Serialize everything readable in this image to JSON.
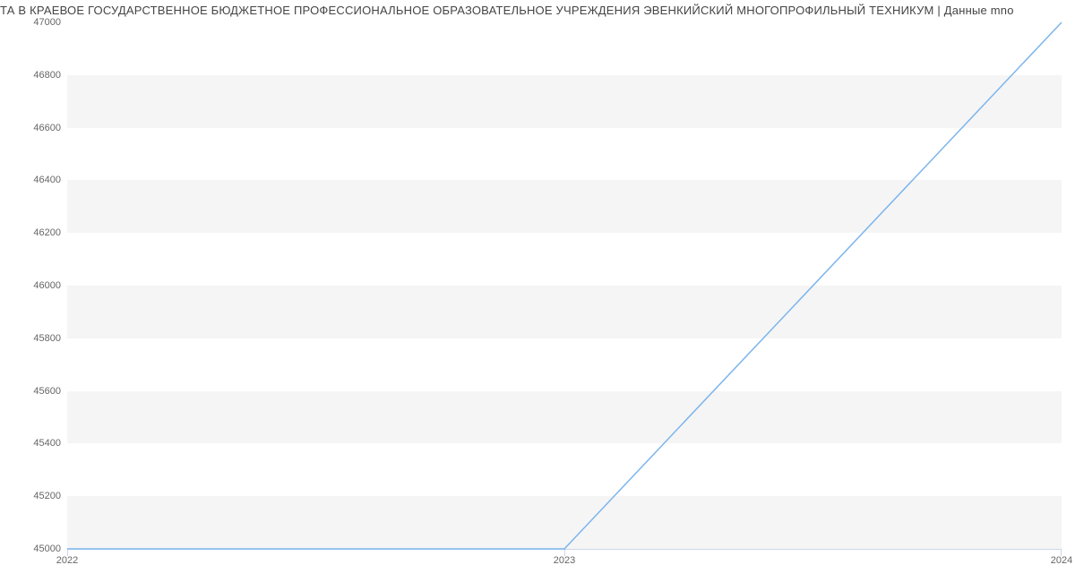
{
  "chart_data": {
    "type": "line",
    "title": "ТА В КРАЕВОЕ ГОСУДАРСТВЕННОЕ БЮДЖЕТНОЕ  ПРОФЕССИОНАЛЬНОЕ ОБРАЗОВАТЕЛЬНОЕ УЧРЕЖДЕНИЯ ЭВЕНКИЙСКИЙ МНОГОПРОФИЛЬНЫЙ ТЕХНИКУМ | Данные mno",
    "x": [
      2022,
      2023,
      2024
    ],
    "values": [
      45000,
      45000,
      47000
    ],
    "xlabel": "",
    "ylabel": "",
    "xlim": [
      2022,
      2024
    ],
    "ylim": [
      45000,
      47000
    ],
    "y_ticks": [
      45000,
      45200,
      45400,
      45600,
      45800,
      46000,
      46200,
      46400,
      46600,
      46800,
      47000
    ],
    "x_ticks": [
      2022,
      2023,
      2024
    ],
    "series_color": "#7cb5ec"
  },
  "labels": {
    "y": {
      "t45000": "45000",
      "t45200": "45200",
      "t45400": "45400",
      "t45600": "45600",
      "t45800": "45800",
      "t46000": "46000",
      "t46200": "46200",
      "t46400": "46400",
      "t46600": "46600",
      "t46800": "46800",
      "t47000": "47000"
    },
    "x": {
      "t2022": "2022",
      "t2023": "2023",
      "t2024": "2024"
    }
  }
}
